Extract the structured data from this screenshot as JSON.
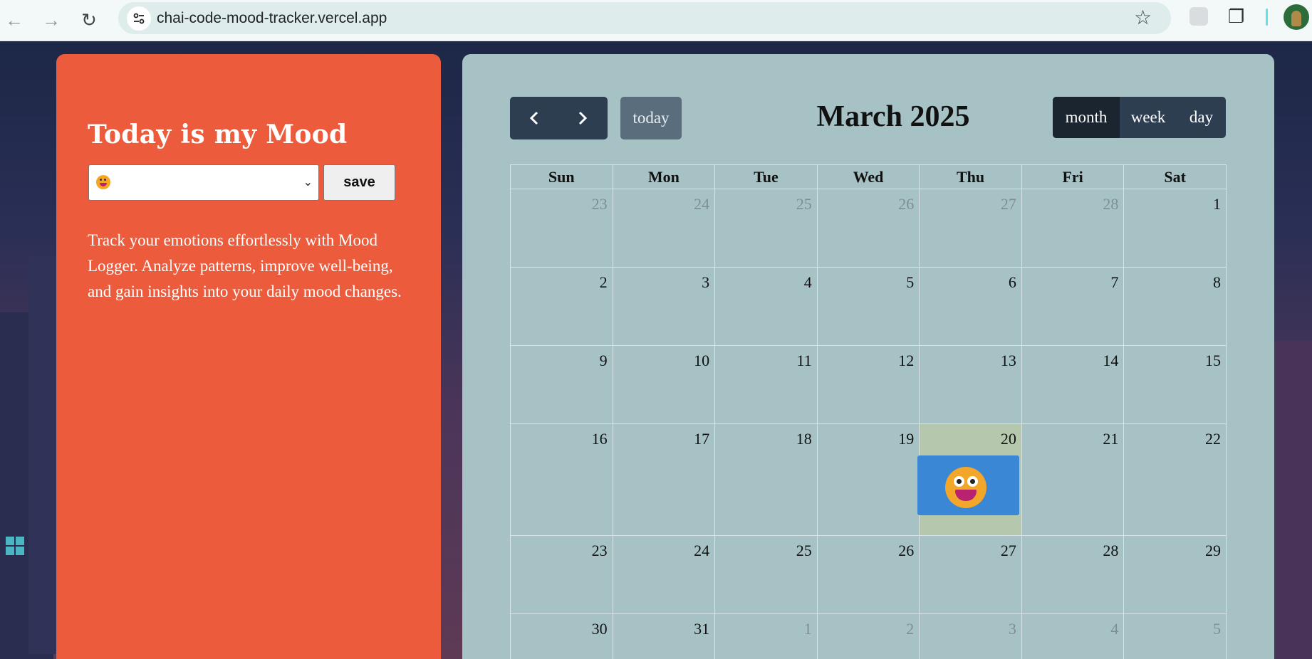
{
  "browser": {
    "url": "chai-code-mood-tracker.vercel.app",
    "back_icon": "arrow-left-icon",
    "forward_icon": "arrow-right-icon",
    "reload_icon": "reload-icon"
  },
  "mood_panel": {
    "title": "Today is my Mood",
    "selected_mood": "grinning-face-emoji",
    "save_label": "save",
    "description": "Track your emotions effortlessly with Mood Logger. Analyze patterns, improve well-being, and gain insights into your daily mood changes."
  },
  "calendar": {
    "title": "March 2025",
    "today_label": "today",
    "views": [
      "month",
      "week",
      "day"
    ],
    "active_view": "month",
    "weekdays": [
      "Sun",
      "Mon",
      "Tue",
      "Wed",
      "Thu",
      "Fri",
      "Sat"
    ],
    "weeks": [
      [
        {
          "d": "23",
          "o": true
        },
        {
          "d": "24",
          "o": true
        },
        {
          "d": "25",
          "o": true
        },
        {
          "d": "26",
          "o": true
        },
        {
          "d": "27",
          "o": true
        },
        {
          "d": "28",
          "o": true
        },
        {
          "d": "1",
          "o": false
        }
      ],
      [
        {
          "d": "2",
          "o": false
        },
        {
          "d": "3",
          "o": false
        },
        {
          "d": "4",
          "o": false
        },
        {
          "d": "5",
          "o": false
        },
        {
          "d": "6",
          "o": false
        },
        {
          "d": "7",
          "o": false
        },
        {
          "d": "8",
          "o": false
        }
      ],
      [
        {
          "d": "9",
          "o": false
        },
        {
          "d": "10",
          "o": false
        },
        {
          "d": "11",
          "o": false
        },
        {
          "d": "12",
          "o": false
        },
        {
          "d": "13",
          "o": false
        },
        {
          "d": "14",
          "o": false
        },
        {
          "d": "15",
          "o": false
        }
      ],
      [
        {
          "d": "16",
          "o": false
        },
        {
          "d": "17",
          "o": false
        },
        {
          "d": "18",
          "o": false
        },
        {
          "d": "19",
          "o": false
        },
        {
          "d": "20",
          "o": false,
          "today": true,
          "event": "grinning-face-emoji"
        },
        {
          "d": "21",
          "o": false
        },
        {
          "d": "22",
          "o": false
        }
      ],
      [
        {
          "d": "23",
          "o": false
        },
        {
          "d": "24",
          "o": false
        },
        {
          "d": "25",
          "o": false
        },
        {
          "d": "26",
          "o": false
        },
        {
          "d": "27",
          "o": false
        },
        {
          "d": "28",
          "o": false
        },
        {
          "d": "29",
          "o": false
        }
      ],
      [
        {
          "d": "30",
          "o": false
        },
        {
          "d": "31",
          "o": false
        },
        {
          "d": "1",
          "o": true
        },
        {
          "d": "2",
          "o": true
        },
        {
          "d": "3",
          "o": true
        },
        {
          "d": "4",
          "o": true
        },
        {
          "d": "5",
          "o": true
        }
      ]
    ],
    "colors": {
      "today_bg": "#b5c7ac",
      "event_bg": "#3a87d6",
      "button_bg": "#2c3e50"
    }
  },
  "colors": {
    "left_card": "#ec5c3c",
    "calendar_card": "#a6c2c4"
  }
}
